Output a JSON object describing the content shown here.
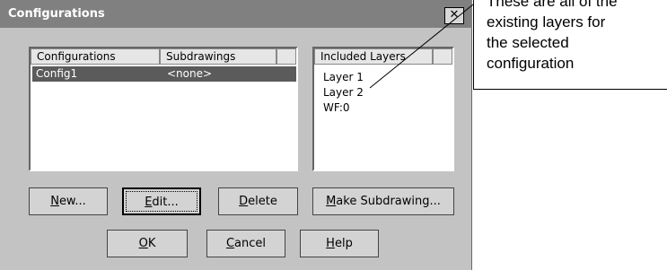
{
  "dialog": {
    "title": "Configurations",
    "close_symbol": "✕"
  },
  "config_list": {
    "headers": [
      "Configurations",
      "Subdrawings"
    ],
    "rows": [
      {
        "config": "Config1",
        "subdrawing": "<none>"
      }
    ]
  },
  "layers_list": {
    "header": "Included Layers",
    "items": [
      "Layer 1",
      "Layer 2",
      "WF:0"
    ]
  },
  "buttons": {
    "new": {
      "hotkey": "N",
      "rest": "ew..."
    },
    "edit": {
      "hotkey": "E",
      "rest": "dit..."
    },
    "delete": {
      "hotkey": "D",
      "rest": "elete"
    },
    "make_subdrawing": {
      "hotkey": "M",
      "rest": "ake Subdrawing..."
    },
    "ok": {
      "hotkey": "O",
      "rest": "K"
    },
    "cancel": {
      "hotkey": "C",
      "rest": "ancel"
    },
    "help": {
      "hotkey": "H",
      "rest": "elp"
    }
  },
  "callout": {
    "lines": [
      "These are all of the",
      "existing layers for",
      "the selected",
      "configuration"
    ]
  }
}
